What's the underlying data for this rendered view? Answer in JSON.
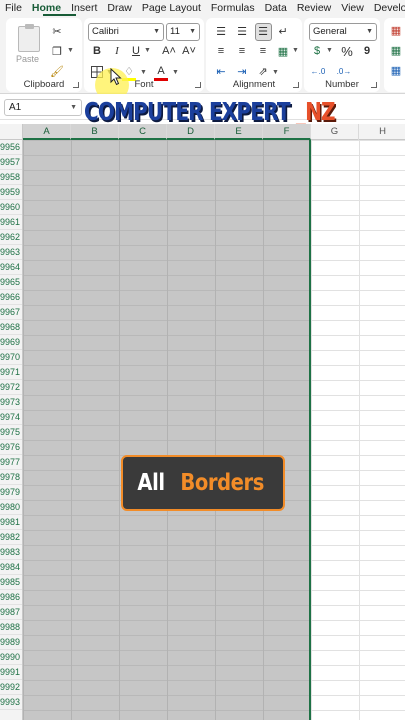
{
  "tabs": [
    "File",
    "Home",
    "Insert",
    "Draw",
    "Page Layout",
    "Formulas",
    "Data",
    "Review",
    "View",
    "Developer"
  ],
  "active_tab": "Home",
  "ribbon": {
    "clipboard": {
      "label": "Clipboard",
      "paste_label": "Paste"
    },
    "font": {
      "label": "Font",
      "font_name": "Calibri",
      "font_size": "11",
      "bold": "B",
      "italic": "I",
      "underline": "U",
      "grow": "A˄",
      "shrink": "A˅",
      "font_color": "A"
    },
    "alignment": {
      "label": "Alignment"
    },
    "number": {
      "label": "Number",
      "format": "General",
      "currency": "$",
      "percent": "%",
      "comma": "9"
    }
  },
  "namebox": {
    "value": "A1"
  },
  "watermark": {
    "part1": "COMPUTER EXPERT ",
    "part2": "_NZ"
  },
  "columns": [
    "A",
    "B",
    "C",
    "D",
    "E",
    "F",
    "G",
    "H"
  ],
  "rows": [
    "9956",
    "9957",
    "9958",
    "9959",
    "9960",
    "9961",
    "9962",
    "9963",
    "9964",
    "9965",
    "9966",
    "9967",
    "9968",
    "9969",
    "9970",
    "9971",
    "9972",
    "9973",
    "9974",
    "9975",
    "9976",
    "9977",
    "9978",
    "9979",
    "9980",
    "9981",
    "9982",
    "9983",
    "9984",
    "9985",
    "9986",
    "9987",
    "9988",
    "9989",
    "9990",
    "9991",
    "9992",
    "9993"
  ],
  "caption": {
    "word1": "All",
    "word2": "Borders"
  },
  "colors": {
    "excel_green": "#1e7145",
    "accent_orange": "#f28c28",
    "selection_gray": "#c6c6c6"
  }
}
